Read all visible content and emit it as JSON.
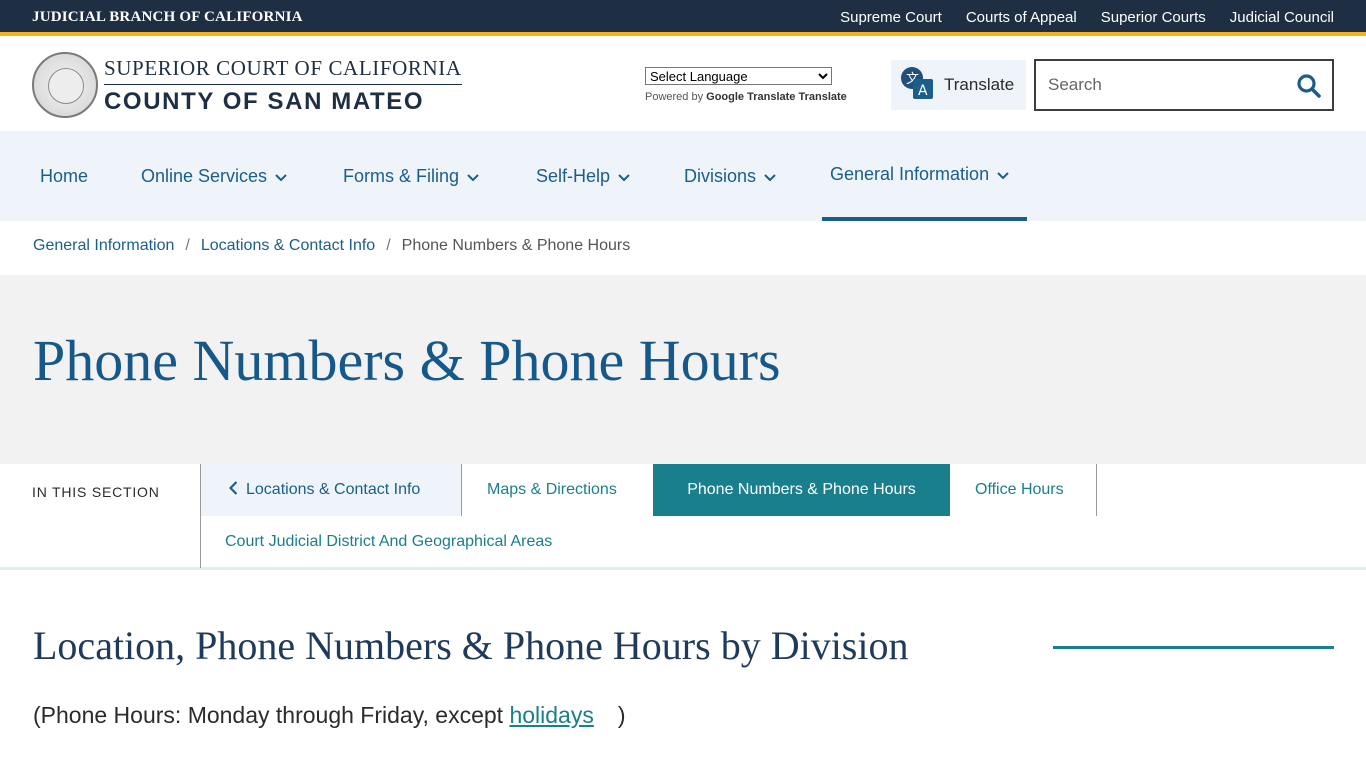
{
  "topbar": {
    "brand": "JUDICIAL BRANCH OF CALIFORNIA",
    "links": [
      "Supreme Court",
      "Courts of Appeal",
      "Superior Courts",
      "Judicial Council"
    ],
    "bg_color": "#1f2f43",
    "accent_color": "#f2b51c"
  },
  "header": {
    "court_line1": "SUPERIOR COURT OF CALIFORNIA",
    "court_line2": "COUNTY OF SAN MATEO",
    "seal_icon": "court-seal-logo",
    "language_select": "Select Language",
    "powered_by": "Powered by",
    "google_translate": "Google Translate",
    "translate_word": "Translate",
    "translate_button": "Translate",
    "search_placeholder": "Search"
  },
  "nav": {
    "items": [
      {
        "label": "Home",
        "has_dropdown": false
      },
      {
        "label": "Online Services",
        "has_dropdown": true
      },
      {
        "label": "Forms & Filing",
        "has_dropdown": true
      },
      {
        "label": "Self-Help",
        "has_dropdown": true
      },
      {
        "label": "Divisions",
        "has_dropdown": true
      },
      {
        "label": "General Information",
        "has_dropdown": true,
        "active": true
      }
    ]
  },
  "breadcrumb": {
    "items": [
      "General Information",
      "Locations & Contact Info"
    ],
    "separator": "/",
    "current": "Phone Numbers & Phone Hours"
  },
  "page": {
    "title": "Phone Numbers & Phone Hours"
  },
  "section_nav": {
    "label": "IN THIS SECTION",
    "back": "Locations & Contact Info",
    "items": [
      "Maps & Directions",
      "Phone Numbers & Phone Hours",
      "Office Hours",
      "Court Judicial District And Geographical Areas"
    ],
    "active": "Phone Numbers & Phone Hours"
  },
  "content": {
    "heading": "Location, Phone Numbers & Phone Hours by Division",
    "para_prefix": "(Phone Hours: Monday through Friday, except ",
    "holidays_link": "holidays",
    "para_suffix": ")"
  },
  "colors": {
    "link_blue": "#1b5e8a",
    "teal": "#1a7f8c",
    "nav_bg": "#eef4fa",
    "title_band": "#f2f2f2"
  }
}
